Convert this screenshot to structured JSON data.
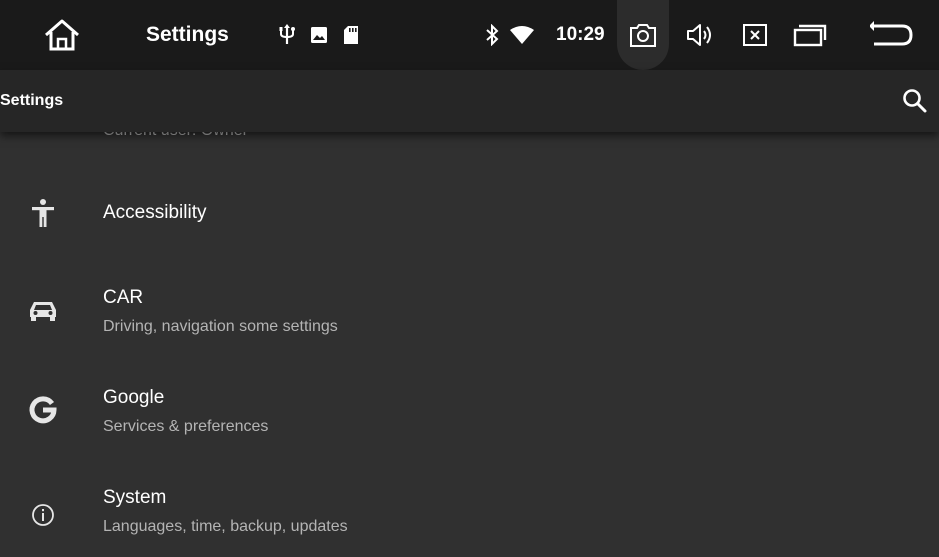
{
  "status_bar": {
    "title": "Settings",
    "time": "10:29",
    "icons": [
      "home-icon",
      "usb-icon",
      "image-icon",
      "sd-card-icon",
      "bluetooth-icon",
      "wifi-icon",
      "screenshot-icon",
      "volume-icon",
      "close-icon",
      "recents-icon",
      "back-icon"
    ]
  },
  "app_bar": {
    "title": "Settings",
    "search_icon": "search-icon"
  },
  "list": {
    "clipped_subtitle": "Current user: Owner",
    "items": [
      {
        "icon": "accessibility-icon",
        "title": "Accessibility",
        "subtitle": ""
      },
      {
        "icon": "car-icon",
        "title": "CAR",
        "subtitle": "Driving, navigation some settings"
      },
      {
        "icon": "google-icon",
        "title": "Google",
        "subtitle": "Services & preferences"
      },
      {
        "icon": "info-icon",
        "title": "System",
        "subtitle": "Languages, time, backup, updates"
      }
    ]
  },
  "colors": {
    "status_bar_bg": "#1a1a1a",
    "app_bar_bg": "#262626",
    "list_bg": "#303030",
    "text_primary": "#ffffff",
    "text_secondary": "#b4b4b4"
  }
}
